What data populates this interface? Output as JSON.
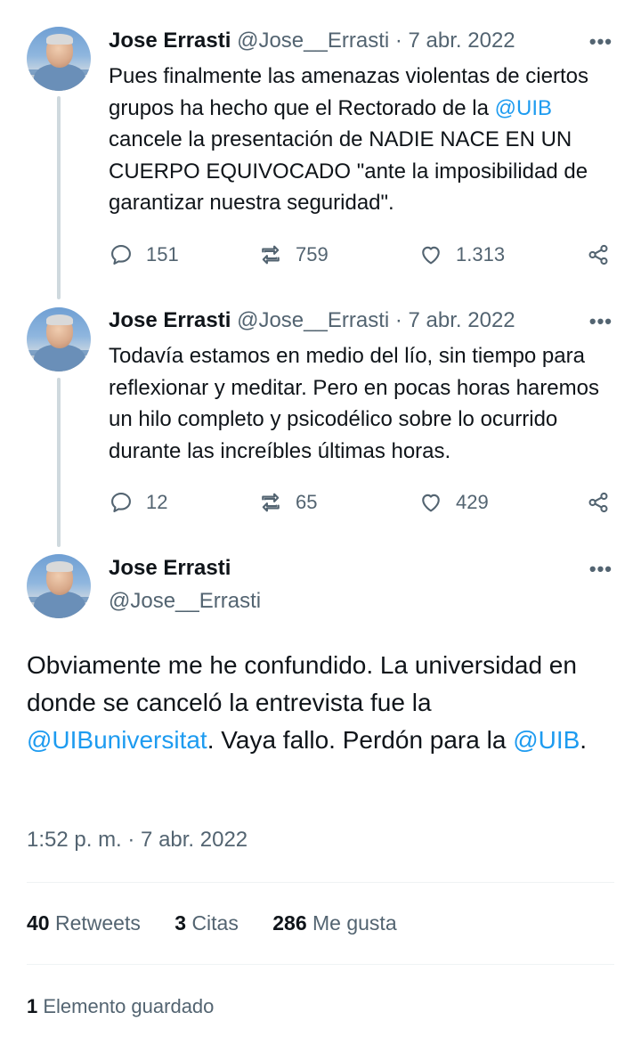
{
  "tweets": [
    {
      "author_name": "Jose Errasti",
      "author_handle": "@Jose__Errasti",
      "separator": "·",
      "date": "7 abr. 2022",
      "more_label": "•••",
      "text_parts": {
        "a": "Pues finalmente las amenazas violentas de ciertos grupos ha hecho que el Rectorado de la ",
        "mention": "@UIB",
        "b": " cancele la presentación de NADIE NACE EN UN CUERPO EQUIVOCADO \"ante la imposibilidad de garantizar nuestra seguridad\"."
      },
      "replies": "151",
      "retweets": "759",
      "likes": "1.313"
    },
    {
      "author_name": "Jose Errasti",
      "author_handle": "@Jose__Errasti",
      "separator": "·",
      "date": "7 abr. 2022",
      "more_label": "•••",
      "text": "Todavía estamos en medio del lío, sin tiempo para reflexionar y meditar. Pero en pocas horas haremos un hilo completo y psicodélico sobre lo ocurrido durante las increíbles últimas horas.",
      "replies": "12",
      "retweets": "65",
      "likes": "429"
    }
  ],
  "main_tweet": {
    "author_name": "Jose Errasti",
    "author_handle": "@Jose__Errasti",
    "more_label": "•••",
    "text_a": "Obviamente me he confundido. La universidad en donde se canceló la entrevista fue la ",
    "mention_1": "@UIBuniversitat",
    "text_b": ". Vaya fallo. Perdón para la ",
    "mention_2": "@UIB",
    "text_c": ".",
    "timestamp": "1:52 p. m. · 7 abr. 2022",
    "retweets_count": "40",
    "retweets_label": "Retweets",
    "quotes_count": "3",
    "quotes_label": "Citas",
    "likes_count": "286",
    "likes_label": "Me gusta",
    "bookmarks_count": "1",
    "bookmarks_label": "Elemento guardado"
  },
  "icons": {
    "reply": "reply-icon",
    "retweet": "retweet-icon",
    "like": "heart-icon",
    "share": "share-icon",
    "more": "more-icon"
  },
  "colors": {
    "link": "#1d9bf0",
    "secondary_text": "#536471",
    "thread_line": "#cfd9de"
  }
}
